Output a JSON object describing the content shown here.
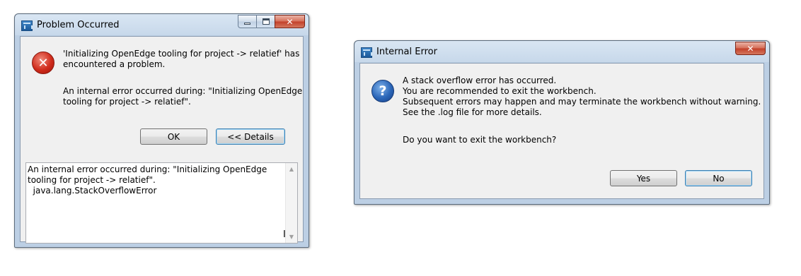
{
  "problem_dialog": {
    "title": "Problem Occurred",
    "icon": "error-icon",
    "message_line1": "'Initializing OpenEdge tooling for project -> relatief' has",
    "message_line2": "encountered a problem.",
    "detail_line1": "An internal error occurred during: \"Initializing OpenEdge",
    "detail_line2": "tooling for project -> relatief\".",
    "ok_label": "OK",
    "details_label": "<< Details",
    "details_text": "An internal error occurred during: \"Initializing OpenEdge\ntooling for project -> relatief\".\n  java.lang.StackOverflowError",
    "window_buttons": {
      "minimize": "minimize-icon",
      "maximize": "maximize-icon",
      "close": "close-icon"
    }
  },
  "internal_error_dialog": {
    "title": "Internal Error",
    "icon": "question-icon",
    "lines": [
      "A stack overflow error has occurred.",
      "You are recommended to exit the workbench.",
      "Subsequent errors may happen and may terminate the workbench without warning.",
      "See the .log file for more details."
    ],
    "question": "Do you want to exit the workbench?",
    "yes_label": "Yes",
    "no_label": "No"
  },
  "colors": {
    "frame": "#c7d8ea",
    "client": "#f0f0f0",
    "close_button": "#c2402a",
    "default_button_border": "#3c7fb1"
  }
}
